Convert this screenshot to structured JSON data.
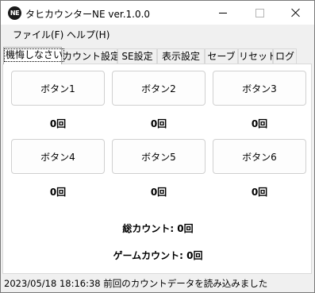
{
  "window": {
    "title": "タヒカウンターNE ver.1.0.0",
    "icon_text": "NE",
    "controls": [
      "minimize-icon",
      "maximize-icon",
      "close-icon"
    ]
  },
  "menu": {
    "file": "ファイル(F)",
    "help": "ヘルプ(H)"
  },
  "tabs": [
    {
      "label": "機悔しなさい",
      "active": true
    },
    {
      "label": "カウント設定",
      "active": false
    },
    {
      "label": "SE設定",
      "active": false
    },
    {
      "label": "表示設定",
      "active": false
    },
    {
      "label": "セーブ",
      "active": false
    },
    {
      "label": "リセット",
      "active": false
    },
    {
      "label": "ログ",
      "active": false
    }
  ],
  "counters": [
    {
      "label": "ボタン1",
      "count": "0回"
    },
    {
      "label": "ボタン2",
      "count": "0回"
    },
    {
      "label": "ボタン3",
      "count": "0回"
    },
    {
      "label": "ボタン4",
      "count": "0回"
    },
    {
      "label": "ボタン5",
      "count": "0回"
    },
    {
      "label": "ボタン6",
      "count": "0回"
    }
  ],
  "totals": {
    "total": "総カウント: 0回",
    "game": "ゲームカウント: 0回"
  },
  "status": "2023/05/18 18:16:38 前回のカウントデータを読み込みました"
}
